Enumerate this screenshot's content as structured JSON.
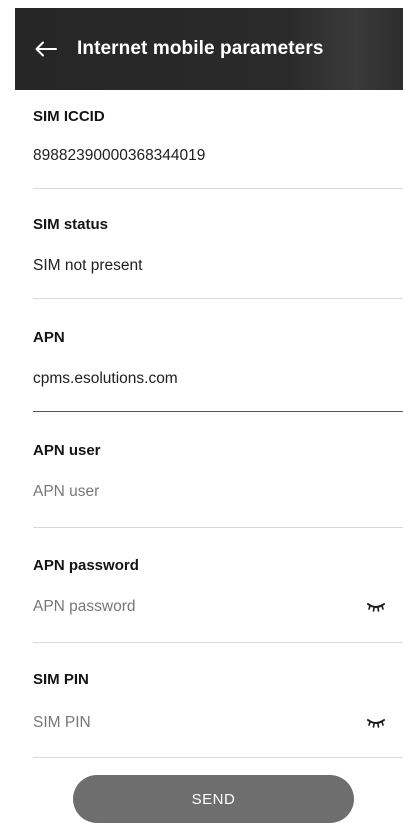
{
  "header": {
    "title": "Internet mobile parameters"
  },
  "fields": {
    "sim_iccid": {
      "label": "SIM ICCID",
      "value": "89882390000368344019"
    },
    "sim_status": {
      "label": "SIM status",
      "value": "SIM not present"
    },
    "apn": {
      "label": "APN",
      "value": "cpms.esolutions.com"
    },
    "apn_user": {
      "label": "APN user",
      "placeholder": "APN user",
      "value": ""
    },
    "apn_password": {
      "label": "APN password",
      "placeholder": "APN password",
      "value": ""
    },
    "sim_pin": {
      "label": "SIM PIN",
      "placeholder": "SIM PIN",
      "value": ""
    }
  },
  "actions": {
    "send_label": "SEND"
  },
  "colors": {
    "header_bg": "#262626",
    "send_bg": "#6e6e6e",
    "divider": "#d8d8d8",
    "divider_active": "#555555"
  },
  "icons": {
    "back": "back-arrow-icon",
    "password_toggle": "eye-closed-icon"
  }
}
